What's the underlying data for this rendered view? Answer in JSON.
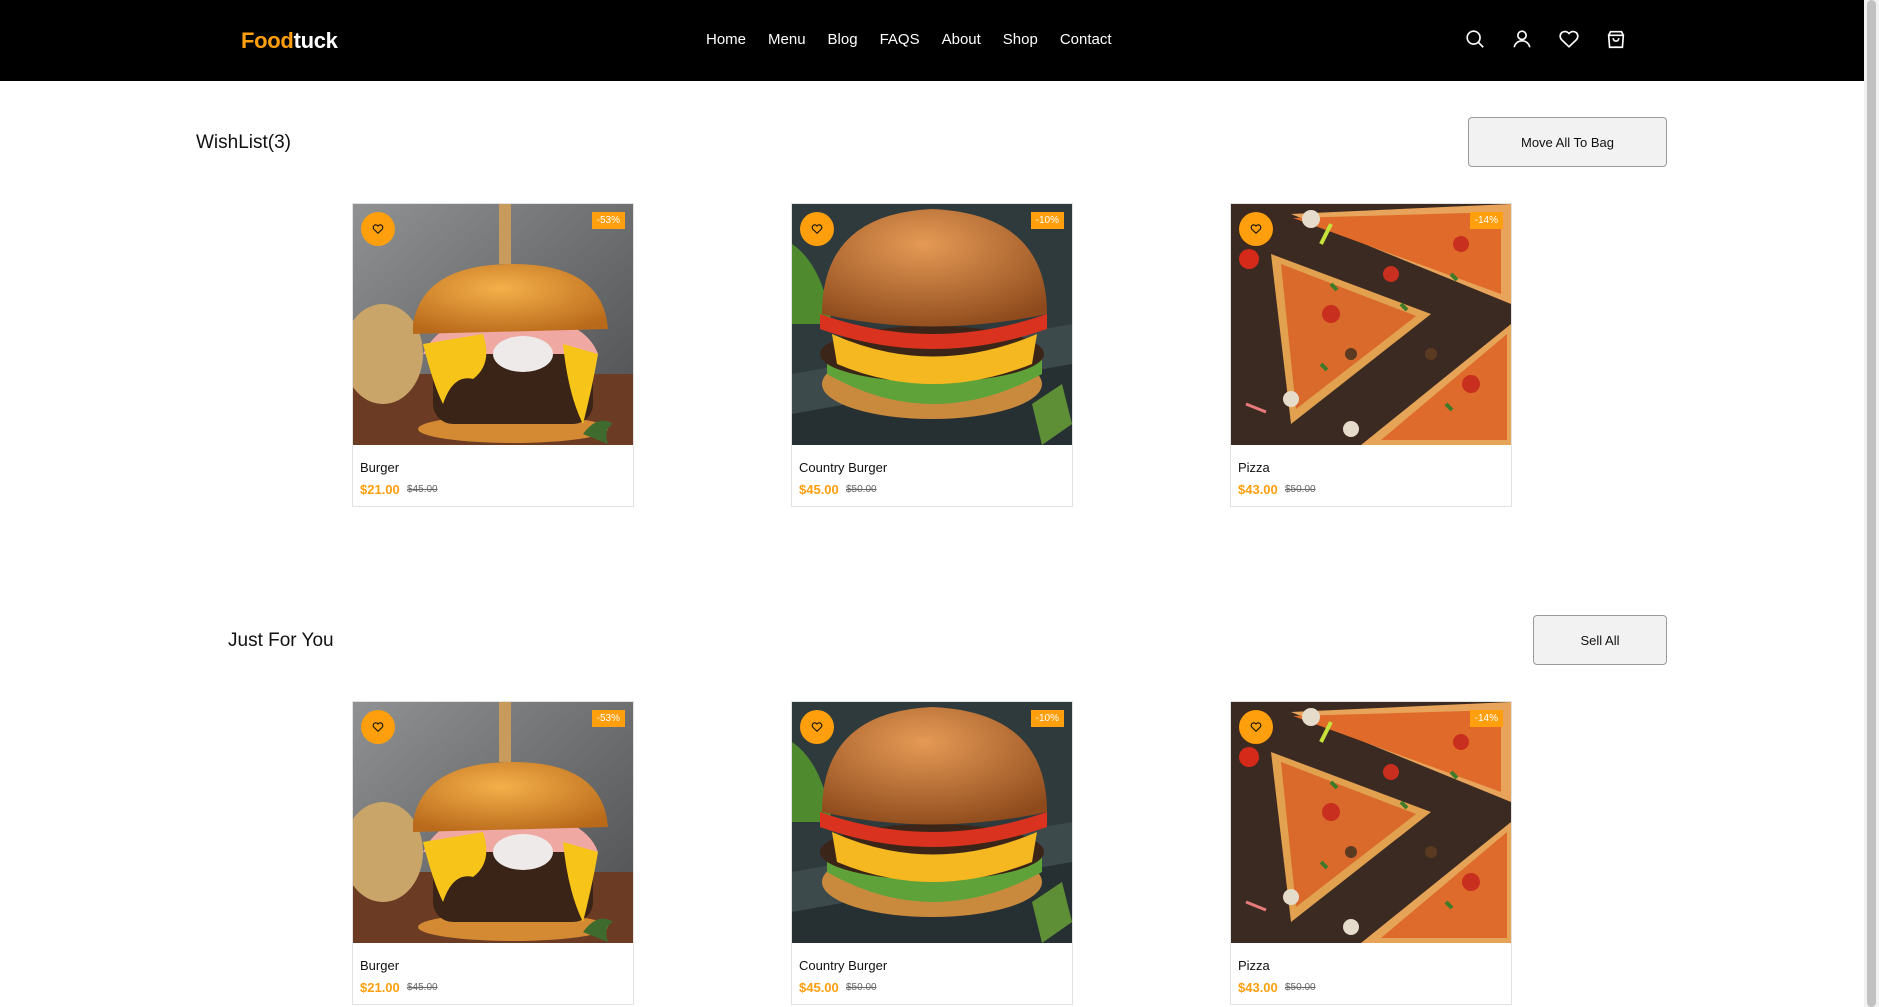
{
  "header": {
    "logo_part1": "Food",
    "logo_part2": "tuck",
    "nav": [
      "Home",
      "Menu",
      "Blog",
      "FAQS",
      "About",
      "Shop",
      "Contact"
    ],
    "icons": [
      "search-icon",
      "user-icon",
      "heart-icon",
      "bag-icon"
    ]
  },
  "colors": {
    "accent": "#FF9F0D",
    "header_bg": "#000000"
  },
  "wishlist": {
    "title": "WishList(3)",
    "button": "Move All To Bag",
    "items": [
      {
        "name": "Burger",
        "price": "$21.00",
        "old_price": "$45.00",
        "discount": "-53%",
        "image": "burger"
      },
      {
        "name": "Country Burger",
        "price": "$45.00",
        "old_price": "$50.00",
        "discount": "-10%",
        "image": "country-burger"
      },
      {
        "name": "Pizza",
        "price": "$43.00",
        "old_price": "$50.00",
        "discount": "-14%",
        "image": "pizza"
      }
    ]
  },
  "just_for_you": {
    "title": "Just For You",
    "button": "Sell All",
    "items": [
      {
        "name": "Burger",
        "price": "$21.00",
        "old_price": "$45.00",
        "discount": "-53%",
        "image": "burger"
      },
      {
        "name": "Country Burger",
        "price": "$45.00",
        "old_price": "$50.00",
        "discount": "-10%",
        "image": "country-burger"
      },
      {
        "name": "Pizza",
        "price": "$43.00",
        "old_price": "$50.00",
        "discount": "-14%",
        "image": "pizza"
      }
    ]
  }
}
